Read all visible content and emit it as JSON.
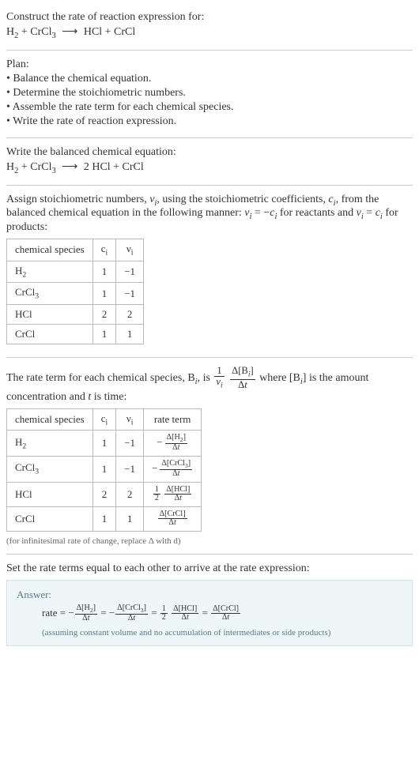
{
  "prompt": {
    "title": "Construct the rate of reaction expression for:",
    "equation_html": "H<sub>2</sub> + CrCl<sub>3</sub> <span class='arrow'>⟶</span> HCl + CrCl"
  },
  "plan": {
    "heading": "Plan:",
    "items": [
      "Balance the chemical equation.",
      "Determine the stoichiometric numbers.",
      "Assemble the rate term for each chemical species.",
      "Write the rate of reaction expression."
    ]
  },
  "balanced": {
    "heading": "Write the balanced chemical equation:",
    "equation_html": "H<sub>2</sub> + CrCl<sub>3</sub> <span class='arrow'>⟶</span> 2 HCl + CrCl"
  },
  "stoich": {
    "intro_html": "Assign stoichiometric numbers, <span class='math-i'>ν<sub>i</sub></span>, using the stoichiometric coefficients, <span class='math-i'>c<sub>i</sub></span>, from the balanced chemical equation in the following manner: <span class='math-i'>ν<sub>i</sub></span> = −<span class='math-i'>c<sub>i</sub></span> for reactants and <span class='math-i'>ν<sub>i</sub></span> = <span class='math-i'>c<sub>i</sub></span> for products:",
    "headers": {
      "species": "chemical species",
      "c": "c<sub>i</sub>",
      "v": "ν<sub>i</sub>"
    },
    "rows": [
      {
        "species": "H<sub>2</sub>",
        "c": "1",
        "v": "−1"
      },
      {
        "species": "CrCl<sub>3</sub>",
        "c": "1",
        "v": "−1"
      },
      {
        "species": "HCl",
        "c": "2",
        "v": "2"
      },
      {
        "species": "CrCl",
        "c": "1",
        "v": "1"
      }
    ]
  },
  "rateterm": {
    "intro_pre": "The rate term for each chemical species, B",
    "intro_post_html": ", is <span class='frac'><span class='n'>1</span><span class='d'><span class='math-i'>ν<sub>i</sub></span></span></span> <span class='frac'><span class='n'>Δ[B<sub><span class='math-i'>i</span></sub>]</span><span class='d'>Δ<span class='math-i'>t</span></span></span> where [B<sub><span class='math-i'>i</span></sub>] is the amount concentration and <span class='math-i'>t</span> is time:",
    "headers": {
      "species": "chemical species",
      "c": "c<sub>i</sub>",
      "v": "ν<sub>i</sub>",
      "rate": "rate term"
    },
    "rows": [
      {
        "species": "H<sub>2</sub>",
        "c": "1",
        "v": "−1",
        "rate": "<span class='neg'>−</span><span class='sfrac'><span class='n'>Δ[H<sub>2</sub>]</span><span class='d'>Δ<span class='math-i'>t</span></span></span>"
      },
      {
        "species": "CrCl<sub>3</sub>",
        "c": "1",
        "v": "−1",
        "rate": "<span class='neg'>−</span><span class='sfrac'><span class='n'>Δ[CrCl<sub>3</sub>]</span><span class='d'>Δ<span class='math-i'>t</span></span></span>"
      },
      {
        "species": "HCl",
        "c": "2",
        "v": "2",
        "rate": "<span class='sfrac'><span class='n'>1</span><span class='d'>2</span></span> <span class='sfrac'><span class='n'>Δ[HCl]</span><span class='d'>Δ<span class='math-i'>t</span></span></span>"
      },
      {
        "species": "CrCl",
        "c": "1",
        "v": "1",
        "rate": "<span class='sfrac'><span class='n'>Δ[CrCl]</span><span class='d'>Δ<span class='math-i'>t</span></span></span>"
      }
    ],
    "note": "(for infinitesimal rate of change, replace Δ with d)"
  },
  "final": {
    "heading": "Set the rate terms equal to each other to arrive at the rate expression:",
    "answer_label": "Answer:",
    "rate_html": "rate = −<span class='sfrac'><span class='n'>Δ[H<sub>2</sub>]</span><span class='d'>Δ<span class='math-i'>t</span></span></span> = −<span class='sfrac'><span class='n'>Δ[CrCl<sub>3</sub>]</span><span class='d'>Δ<span class='math-i'>t</span></span></span> = <span class='sfrac'><span class='n'>1</span><span class='d'>2</span></span> <span class='sfrac'><span class='n'>Δ[HCl]</span><span class='d'>Δ<span class='math-i'>t</span></span></span> = <span class='sfrac'><span class='n'>Δ[CrCl]</span><span class='d'>Δ<span class='math-i'>t</span></span></span>",
    "note": "(assuming constant volume and no accumulation of intermediates or side products)"
  }
}
